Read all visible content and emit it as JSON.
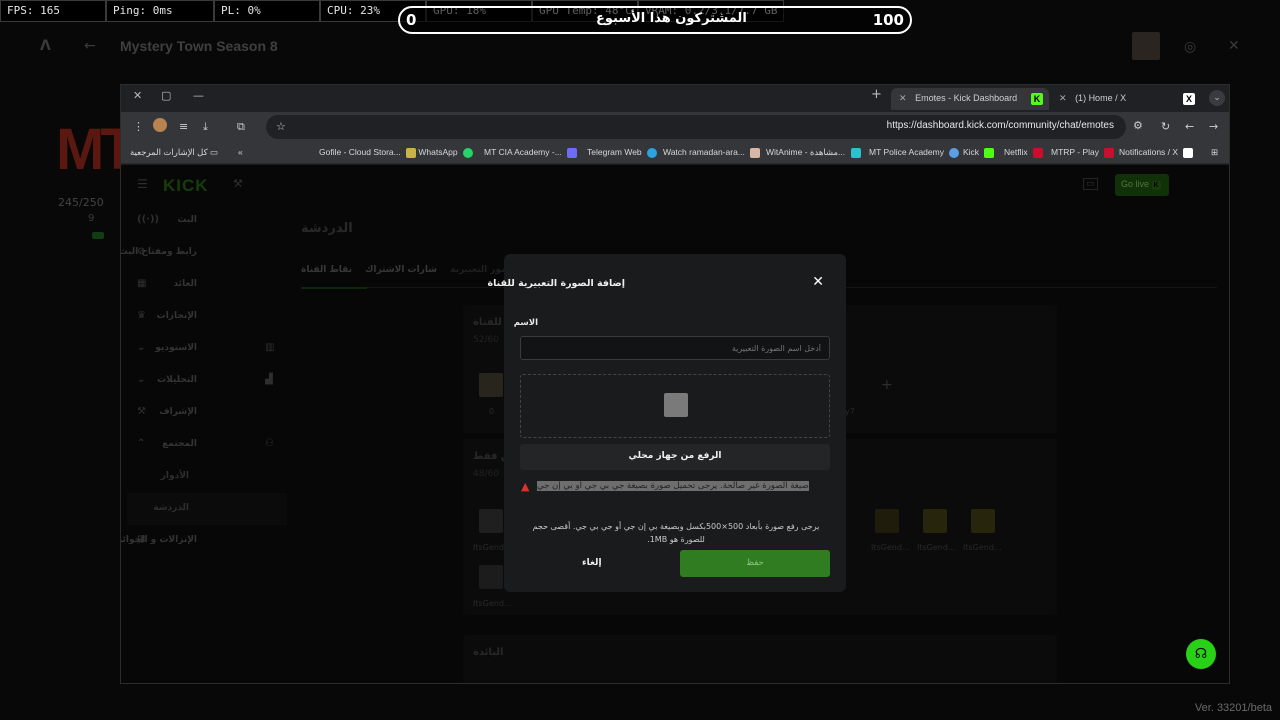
{
  "overlay": {
    "stats": [
      "FPS: 165",
      "Ping: 0ms",
      "PL: 0%",
      "CPU: 23%",
      "GPU: 18%",
      "GPU Temp: 48°C",
      "VRAM: 0.2/3.1/7.7 GB"
    ],
    "sub_counter": {
      "left": "0",
      "label": "المشتركون هذا الأسبوع",
      "right": "100"
    }
  },
  "background_app": {
    "title": "Mystery Town Season 8",
    "count": "245/250",
    "count2": "9",
    "version": "Ver. 33201/beta"
  },
  "browser": {
    "tabs": [
      {
        "label": "Emotes - Kick Dashboard",
        "active": true
      },
      {
        "label": "(1) Home / X",
        "active": false
      }
    ],
    "url": "https://dashboard.kick.com/community/chat/emotes",
    "bookmarks": [
      "Gofile - Cloud Stora...",
      "WhatsApp",
      "MT CIA Academy -...",
      "Telegram Web",
      "Watch ramadan-ara...",
      "WitAnime - مشاهدة...",
      "MT Police Academy",
      "Kick",
      "Netflix",
      "MTRP - Play",
      "Notifications / X"
    ],
    "bookmarks_folder": "كل الإشارات المرجعية"
  },
  "dashboard": {
    "logo": "KICK",
    "go_live": "Go live",
    "page_title": "الدردشة",
    "tabs": [
      "الصور التعبيرية",
      "شارات الاشتراك",
      "نقاط القناة"
    ],
    "sidebar": [
      {
        "label": "البث",
        "icon": "broadcast-icon"
      },
      {
        "label": "رابط ومفتاح البث",
        "icon": "link-icon"
      },
      {
        "label": "العائد",
        "icon": "revenue-icon"
      },
      {
        "label": "الإنجازات",
        "icon": "trophy-icon"
      },
      {
        "label": "الاستوديو",
        "icon": "studio-icon"
      },
      {
        "label": "التحليلات",
        "icon": "analytics-icon"
      },
      {
        "label": "الإشراف",
        "icon": "mod-icon"
      },
      {
        "label": "المجتمع",
        "icon": "community-icon"
      },
      {
        "label": "الأدوار",
        "icon": ""
      },
      {
        "label": "الدردشة",
        "icon": ""
      },
      {
        "label": "الإنزالات و الجوائز",
        "icon": "gift-icon"
      }
    ],
    "card1": {
      "title": "الصور التعبيرية للقناة",
      "count": "52/60"
    },
    "card2": {
      "title": "للمشتركين فقط",
      "count": "48/60"
    },
    "card3": {
      "title": "البائدة"
    },
    "emote_labels": [
      "0",
      "y7",
      "ItsGend...",
      "ItsGend...",
      "ItsGend...",
      "ItsGend...",
      "ItsGend..."
    ]
  },
  "modal": {
    "title": "إضافة الصورة التعبيرية للقناة",
    "name_label": "الاسم",
    "name_placeholder": "أدخل اسم الصورة التعبيرية",
    "upload_button": "الرفع من جهاز محلي",
    "error": "صيغة الصورة غير صالحة. يرجى تحميل صورة بصيغة جي بي جي أو بي إن جي",
    "hint": "يرجى رفع صورة بأبعاد 500×500بكسل وبصيغة بي إن جي أو جي بي جي. أقصى حجم للصورة هو 1MB.",
    "cancel": "إلغاء",
    "save": "حفظ"
  }
}
